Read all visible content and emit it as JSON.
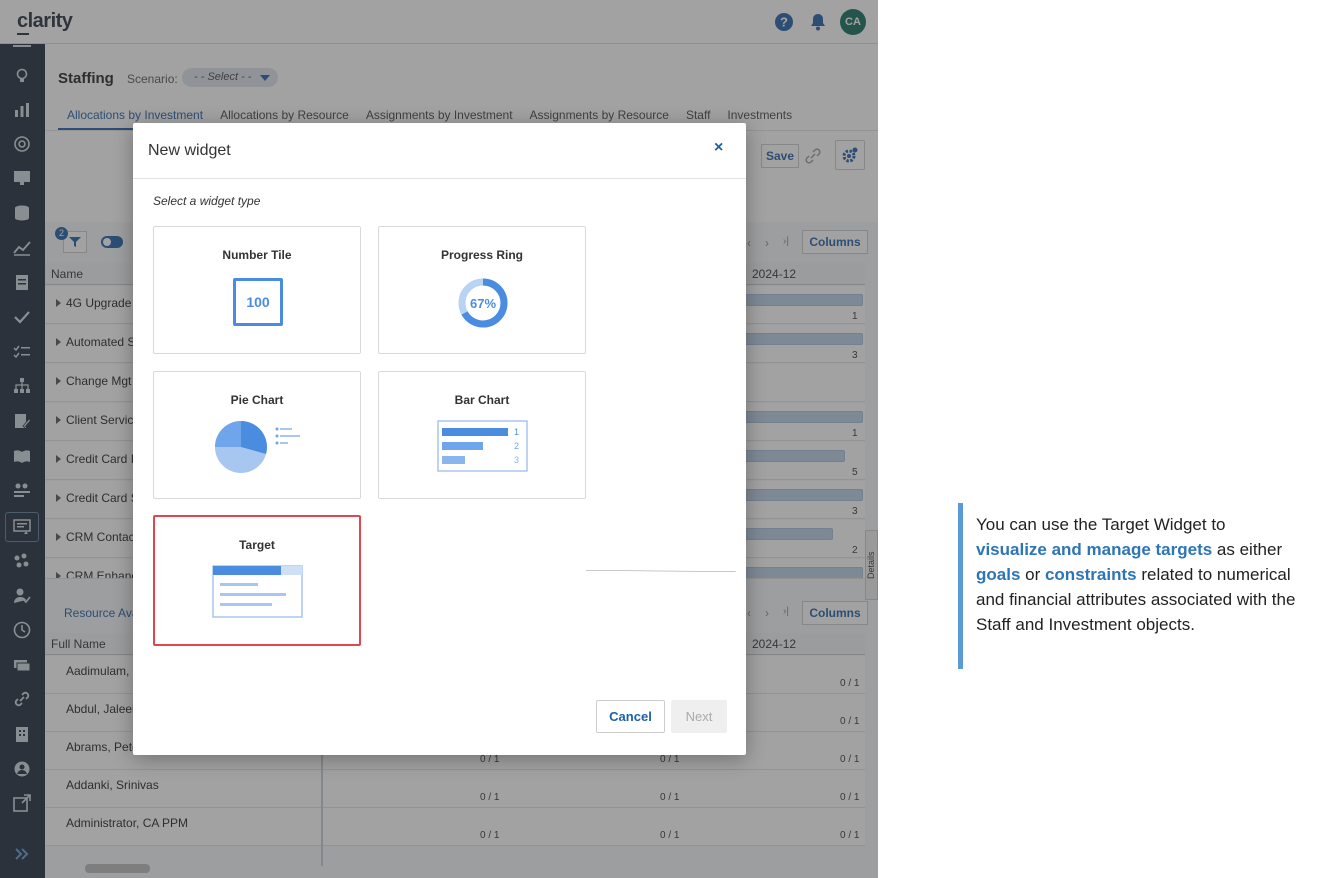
{
  "app": {
    "logo": "clarity",
    "avatar_initials": "CA",
    "page_title": "Staffing",
    "scenario_label": "Scenario:",
    "scenario_value": "- - Select - -",
    "tabs": [
      {
        "label": "Allocations by Investment",
        "active": true
      },
      {
        "label": "Allocations by Resource",
        "active": false
      },
      {
        "label": "Assignments by Investment",
        "active": false
      },
      {
        "label": "Assignments by Resource",
        "active": false
      },
      {
        "label": "Staff",
        "active": false
      },
      {
        "label": "Investments",
        "active": false
      }
    ],
    "toolbar": {
      "save_label": "Save"
    },
    "filter_count": "2",
    "columns_label": "Columns",
    "details_label": "Details",
    "grid1": {
      "name_header": "Name",
      "period_header": "2024-12",
      "rows": [
        {
          "name": "4G Upgrade",
          "value": "1"
        },
        {
          "name": "Automated S",
          "value": "3"
        },
        {
          "name": "Change Mgt",
          "value": ""
        },
        {
          "name": "Client Servic",
          "value": "1"
        },
        {
          "name": "Credit Card I",
          "value": "5"
        },
        {
          "name": "Credit Card S",
          "value": "3"
        },
        {
          "name": "CRM Contac",
          "value": "2"
        },
        {
          "name": "CRM Enhanc",
          "value": ""
        }
      ]
    },
    "grid2": {
      "section_label": "Resource Ava",
      "name_header": "Full Name",
      "period_header": "2024-12",
      "rows": [
        {
          "name": "Aadimulam,",
          "v1": "",
          "v2": "",
          "v3": "0 / 1"
        },
        {
          "name": "Abdul, Jaleel",
          "v1": "",
          "v2": "",
          "v3": "0 / 1"
        },
        {
          "name": "Abrams, Peter",
          "v1": "0 / 1",
          "v2": "0 / 1",
          "v3": "0 / 1"
        },
        {
          "name": "Addanki, Srinivas",
          "v1": "0 / 1",
          "v2": "0 / 1",
          "v3": "0 / 1"
        },
        {
          "name": "Administrator, CA PPM",
          "v1": "0 / 1",
          "v2": "0 / 1",
          "v3": "0 / 1"
        }
      ]
    }
  },
  "modal": {
    "title": "New widget",
    "close_glyph": "×",
    "subtitle": "Select a widget type",
    "cards": {
      "number_tile": {
        "label": "Number Tile",
        "value": "100"
      },
      "progress_ring": {
        "label": "Progress Ring",
        "value": "67%",
        "fraction": 0.67
      },
      "pie_chart": {
        "label": "Pie Chart"
      },
      "bar_chart": {
        "label": "Bar Chart",
        "bars": [
          "1",
          "2",
          "3"
        ]
      },
      "target": {
        "label": "Target"
      }
    },
    "cancel_label": "Cancel",
    "next_label": "Next"
  },
  "callout": {
    "t1": "You can use the Target Widget to",
    "h1": "visualize and manage targets",
    "t2": " as either",
    "h2": "goals",
    "t3": " or ",
    "h3": "constraints",
    "t4": " related to numerical and financial attributes associated with the Staff and Investment objects."
  },
  "colors": {
    "sidebar": "#1c2a3a",
    "accent": "#1e5fa8",
    "highlight_border": "#e0474c",
    "callout_bar": "#5b9bd5",
    "callout_highlight": "#2e75b6"
  }
}
